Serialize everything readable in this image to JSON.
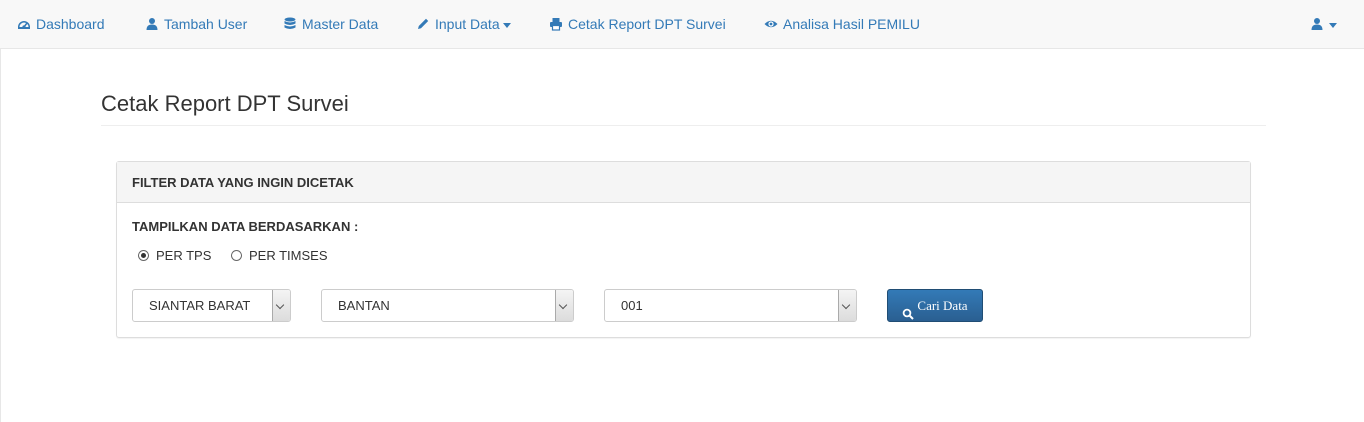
{
  "nav": {
    "items": [
      {
        "label": "Dashboard",
        "icon": "dashboard-icon"
      },
      {
        "label": "Tambah User",
        "icon": "user-icon"
      },
      {
        "label": "Master Data",
        "icon": "database-icon"
      },
      {
        "label": "Input Data",
        "icon": "pencil-icon",
        "dropdown": true
      },
      {
        "label": "Cetak Report DPT Survei",
        "icon": "print-icon"
      },
      {
        "label": "Analisa Hasil PEMILU",
        "icon": "eye-icon"
      }
    ],
    "user_menu_icon": "user-icon"
  },
  "page": {
    "title": "Cetak Report DPT Survei"
  },
  "panel": {
    "heading": "FILTER DATA YANG INGIN DICETAK",
    "filter_label": "TAMPILKAN DATA BERDASARKAN :",
    "radios": [
      {
        "label": "PER TPS",
        "checked": true
      },
      {
        "label": "PER TIMSES",
        "checked": false
      }
    ],
    "selects": [
      {
        "value": "SIANTAR BARAT"
      },
      {
        "value": "BANTAN"
      },
      {
        "value": "001"
      }
    ],
    "button_label": "Cari Data"
  },
  "colors": {
    "link": "#337ab7",
    "button": "#2e6da4",
    "navbar_bg": "#f8f8f8"
  }
}
